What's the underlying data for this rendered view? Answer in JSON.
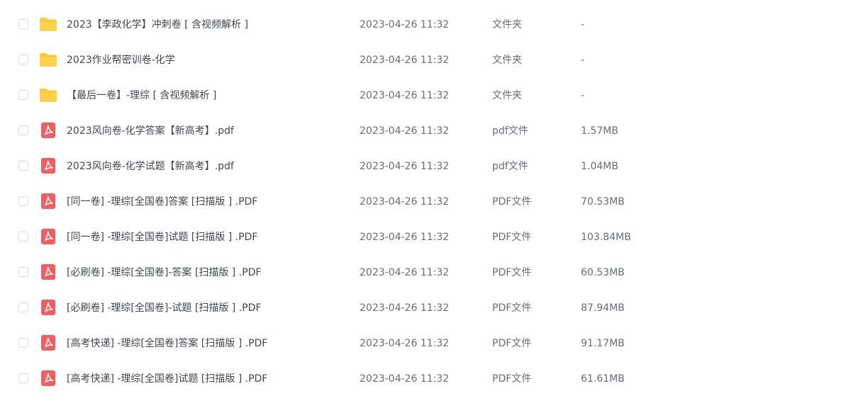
{
  "colors": {
    "folder": "#ffc933",
    "pdf": "#f35d5d",
    "text": "#404652",
    "muted": "#666c78",
    "checkbox_border": "#d9dbe0"
  },
  "files": [
    {
      "name": "2023【李政化学】冲刺卷 [ 含视频解析 ]",
      "date": "2023-04-26 11:32",
      "type": "文件夹",
      "size": "-",
      "icon": "folder-icon"
    },
    {
      "name": "2023作业帮密训卷-化学",
      "date": "2023-04-26 11:32",
      "type": "文件夹",
      "size": "-",
      "icon": "folder-icon"
    },
    {
      "name": "【最后一卷】-理综 [ 含视频解析 ]",
      "date": "2023-04-26 11:32",
      "type": "文件夹",
      "size": "-",
      "icon": "folder-icon"
    },
    {
      "name": "2023风向卷-化学答案【新高考】.pdf",
      "date": "2023-04-26 11:32",
      "type": "pdf文件",
      "size": "1.57MB",
      "icon": "pdf-icon"
    },
    {
      "name": "2023风向卷-化学试题【新高考】.pdf",
      "date": "2023-04-26 11:32",
      "type": "pdf文件",
      "size": "1.04MB",
      "icon": "pdf-icon"
    },
    {
      "name": "[同一卷] -理综[全国卷]答案 [扫描版 ] .PDF",
      "date": "2023-04-26 11:32",
      "type": "PDF文件",
      "size": "70.53MB",
      "icon": "pdf-icon"
    },
    {
      "name": "[同一卷] -理综[全国卷]试题 [扫描版 ] .PDF",
      "date": "2023-04-26 11:32",
      "type": "PDF文件",
      "size": "103.84MB",
      "icon": "pdf-icon"
    },
    {
      "name": "[必刷卷] -理综[全国卷]-答案 [扫描版 ] .PDF",
      "date": "2023-04-26 11:32",
      "type": "PDF文件",
      "size": "60.53MB",
      "icon": "pdf-icon"
    },
    {
      "name": "[必刷卷] -理综[全国卷]-试题 [扫描版 ] .PDF",
      "date": "2023-04-26 11:32",
      "type": "PDF文件",
      "size": "87.94MB",
      "icon": "pdf-icon"
    },
    {
      "name": "[高考快递] -理综[全国卷]答案 [扫描版 ] .PDF",
      "date": "2023-04-26 11:32",
      "type": "PDF文件",
      "size": "91.17MB",
      "icon": "pdf-icon"
    },
    {
      "name": "[高考快递] -理综[全国卷]试题 [扫描版 ] .PDF",
      "date": "2023-04-26 11:32",
      "type": "PDF文件",
      "size": "61.61MB",
      "icon": "pdf-icon"
    }
  ]
}
